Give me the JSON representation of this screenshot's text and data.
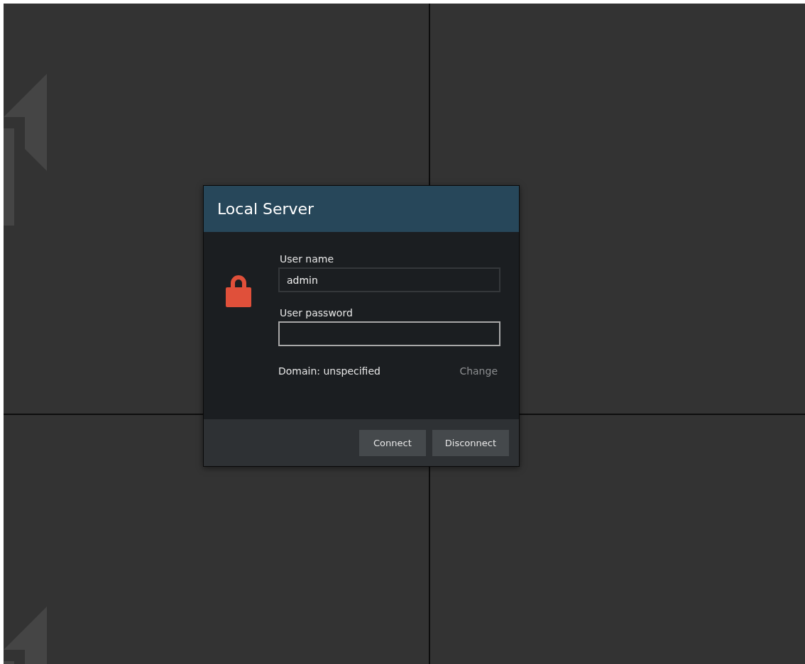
{
  "dialog": {
    "title": "Local Server",
    "fields": [
      {
        "label": "User name",
        "value": "admin",
        "focused": false
      },
      {
        "label": "User password",
        "focused": true
      }
    ],
    "domain": "Domain: unspecified",
    "change_link": "Change",
    "buttons": [
      "Connect",
      "Disconnect"
    ]
  }
}
